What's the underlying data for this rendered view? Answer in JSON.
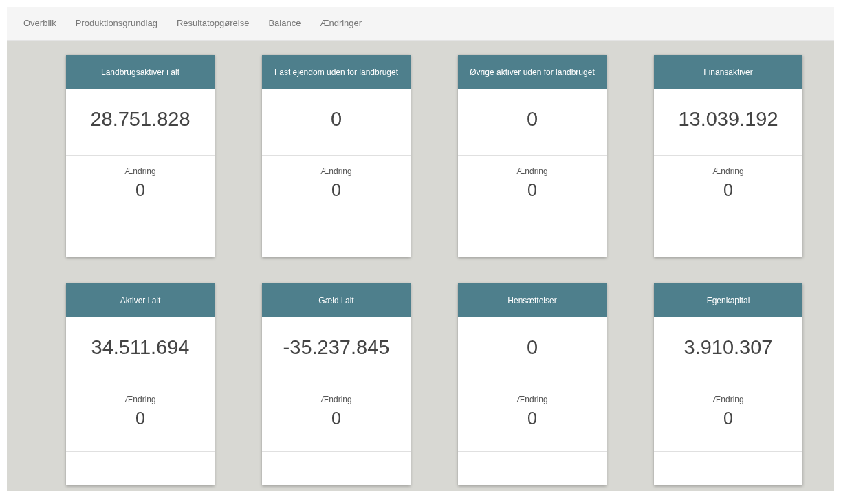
{
  "tabs": [
    {
      "label": "Overblik"
    },
    {
      "label": "Produktionsgrundlag"
    },
    {
      "label": "Resultatopgørelse"
    },
    {
      "label": "Balance"
    },
    {
      "label": "Ændringer"
    }
  ],
  "cards": [
    {
      "title": "Landbrugsaktiver i alt",
      "value": "28.751.828",
      "change_label": "Ændring",
      "change": "0"
    },
    {
      "title": "Fast ejendom uden for landbruget",
      "value": "0",
      "change_label": "Ændring",
      "change": "0"
    },
    {
      "title": "Øvrige aktiver uden for landbruget",
      "value": "0",
      "change_label": "Ændring",
      "change": "0"
    },
    {
      "title": "Finansaktiver",
      "value": "13.039.192",
      "change_label": "Ændring",
      "change": "0"
    },
    {
      "title": "Aktiver i alt",
      "value": "34.511.694",
      "change_label": "Ændring",
      "change": "0"
    },
    {
      "title": "Gæld i alt",
      "value": "-35.237.845",
      "change_label": "Ændring",
      "change": "0"
    },
    {
      "title": "Hensættelser",
      "value": "0",
      "change_label": "Ændring",
      "change": "0"
    },
    {
      "title": "Egenkapital",
      "value": "3.910.307",
      "change_label": "Ændring",
      "change": "0"
    }
  ]
}
